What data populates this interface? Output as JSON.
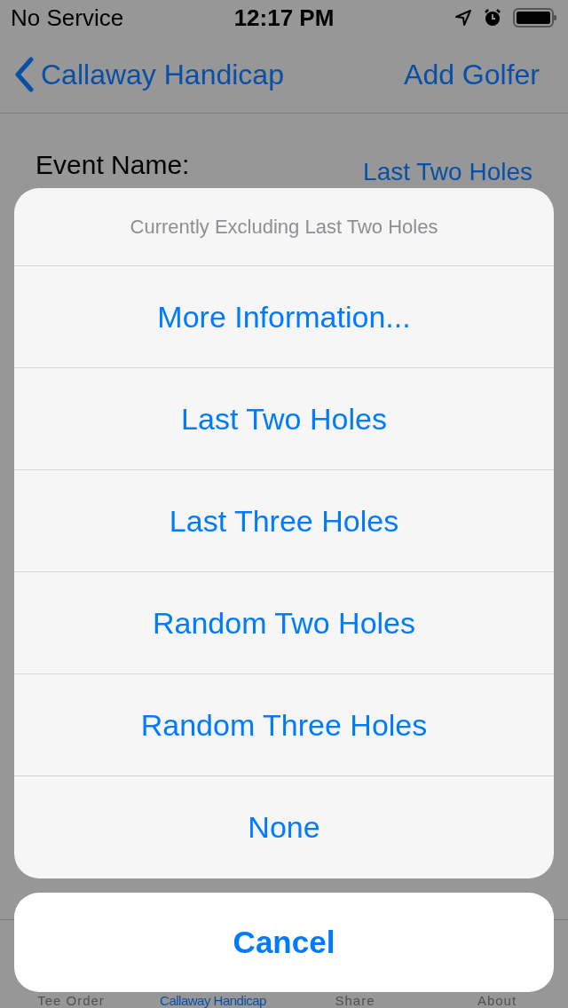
{
  "status_bar": {
    "carrier": "No Service",
    "time": "12:17 PM"
  },
  "nav_bar": {
    "back": "Callaway Handicap",
    "action": "Add Golfer"
  },
  "form": {
    "label": "Event Name:",
    "value": "Last Two Holes"
  },
  "tab_bar": [
    {
      "label": "Tee Order",
      "selected": false
    },
    {
      "label": "Callaway Handicap",
      "selected": true
    },
    {
      "label": "Share",
      "selected": false
    },
    {
      "label": "About",
      "selected": false
    }
  ],
  "action_sheet": {
    "title": "Currently Excluding Last Two Holes",
    "actions": [
      "More Information...",
      "Last Two Holes",
      "Last Three Holes",
      "Random Two Holes",
      "Random Three Holes",
      "None"
    ],
    "cancel": "Cancel"
  }
}
